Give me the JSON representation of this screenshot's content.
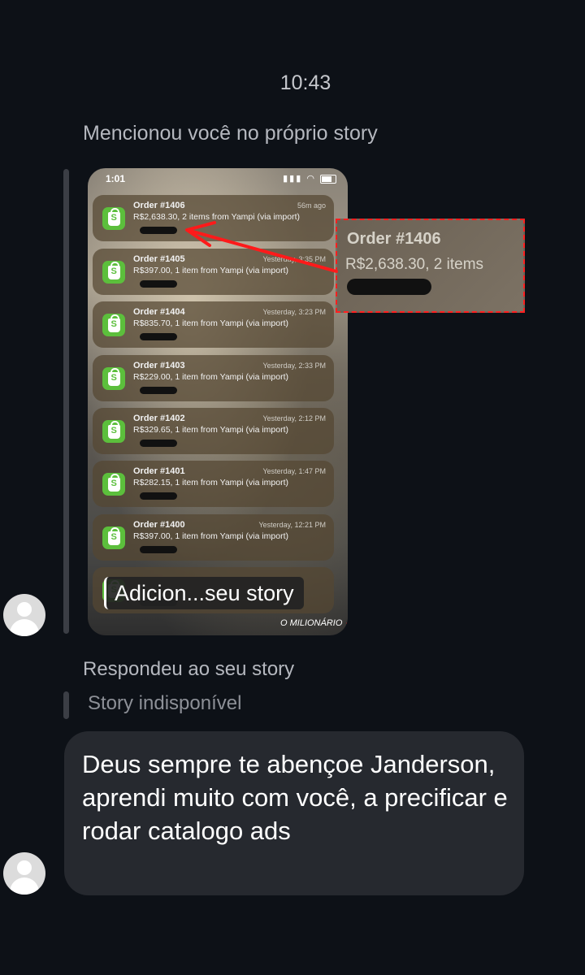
{
  "header": {
    "timestamp": "10:43"
  },
  "story_mention": {
    "context_label": "Mencionou você no próprio story",
    "status_bar": {
      "time": "1:01"
    },
    "notifications": [
      {
        "title": "Order #1406",
        "time": "56m ago",
        "body": "R$2,638.30, 2 items from Yampi (via import)"
      },
      {
        "title": "Order #1405",
        "time": "Yesterday, 3:35 PM",
        "body": "R$397.00, 1 item from Yampi (via import)"
      },
      {
        "title": "Order #1404",
        "time": "Yesterday, 3:23 PM",
        "body": "R$835.70, 1 item from Yampi (via import)"
      },
      {
        "title": "Order #1403",
        "time": "Yesterday, 2:33 PM",
        "body": "R$229.00, 1 item from Yampi (via import)"
      },
      {
        "title": "Order #1402",
        "time": "Yesterday, 2:12 PM",
        "body": "R$329.65, 1 item from Yampi (via import)"
      },
      {
        "title": "Order #1401",
        "time": "Yesterday, 1:47 PM",
        "body": "R$282.15, 1 item from Yampi (via import)"
      },
      {
        "title": "Order #1400",
        "time": "Yesterday, 12:21 PM",
        "body": "R$397.00, 1 item from Yampi (via import)"
      }
    ],
    "story_label": "Adicion...seu story",
    "signature": "O MILIONÁRIO 🚀",
    "zoom": {
      "title": "Order #1406",
      "body": "R$2,638.30, 2 items"
    }
  },
  "reply": {
    "label": "Respondeu ao seu story",
    "unavailable": "Story indisponível"
  },
  "message": {
    "text": "Deus sempre te abençoe Janderson, aprendi muito com você, a precificar e rodar catalogo ads"
  },
  "colors": {
    "background": "#0d1117",
    "bubble": "#26292f",
    "highlight": "#ff2020",
    "shop_icon": "#5cbf3c"
  },
  "icons": {
    "notification": "shopify-bag-icon",
    "avatar": "default-avatar-icon"
  }
}
